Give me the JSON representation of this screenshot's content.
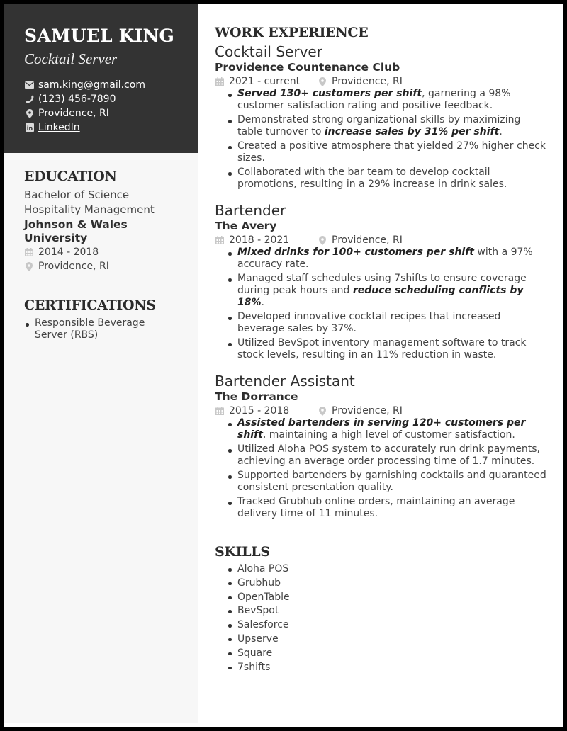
{
  "header": {
    "name": "SAMUEL KING",
    "title": "Cocktail Server",
    "contacts": {
      "email": "sam.king@gmail.com",
      "phone": "(123) 456-7890",
      "location": "Providence, RI",
      "linkedin": "LinkedIn"
    }
  },
  "education": {
    "heading": "EDUCATION",
    "degree": "Bachelor of Science",
    "field": "Hospitality Management",
    "school": "Johnson & Wales University",
    "dates": "2014 - 2018",
    "location": "Providence, RI"
  },
  "certifications": {
    "heading": "CERTIFICATIONS",
    "items": [
      "Responsible Beverage Server (RBS)"
    ]
  },
  "work": {
    "heading": "WORK EXPERIENCE",
    "jobs": [
      {
        "title": "Cocktail Server",
        "company": "Providence Countenance Club",
        "dates": "2021 - current",
        "location": "Providence, RI",
        "bullets": [
          {
            "pre": "",
            "bold": "Served 130+ customers per shift",
            "post": ", garnering a 98% customer satisfaction rating and positive feedback."
          },
          {
            "pre": "Demonstrated strong organizational skills by maximizing table turnover to ",
            "bold": "increase sales by 31% per shift",
            "post": "."
          },
          {
            "pre": "Created a positive atmosphere that yielded 27% higher check sizes.",
            "bold": "",
            "post": ""
          },
          {
            "pre": "Collaborated with the bar team to develop cocktail promotions, resulting in a 29% increase in drink sales.",
            "bold": "",
            "post": ""
          }
        ]
      },
      {
        "title": "Bartender",
        "company": "The Avery",
        "dates": "2018 - 2021",
        "location": "Providence, RI",
        "bullets": [
          {
            "pre": "",
            "bold": "Mixed drinks for 100+ customers per shift",
            "post": " with a 97% accuracy rate."
          },
          {
            "pre": "Managed staff schedules using 7shifts to ensure coverage during peak hours and ",
            "bold": "reduce scheduling conflicts by 18%",
            "post": "."
          },
          {
            "pre": "Developed innovative cocktail recipes that increased beverage sales by 37%.",
            "bold": "",
            "post": ""
          },
          {
            "pre": "Utilized BevSpot inventory management software to track stock levels, resulting in an 11% reduction in waste.",
            "bold": "",
            "post": ""
          }
        ]
      },
      {
        "title": "Bartender Assistant",
        "company": "The Dorrance",
        "dates": "2015 - 2018",
        "location": "Providence, RI",
        "bullets": [
          {
            "pre": "",
            "bold": "Assisted bartenders in serving 120+ customers per shift",
            "post": ", maintaining a high level of customer satisfaction."
          },
          {
            "pre": "Utilized Aloha POS system to accurately run drink payments, achieving an average order processing time of 1.7 minutes.",
            "bold": "",
            "post": ""
          },
          {
            "pre": "Supported bartenders by garnishing cocktails and guaranteed consistent presentation quality.",
            "bold": "",
            "post": ""
          },
          {
            "pre": "Tracked Grubhub online orders, maintaining an average delivery time of 11 minutes.",
            "bold": "",
            "post": ""
          }
        ]
      }
    ]
  },
  "skills": {
    "heading": "SKILLS",
    "items": [
      "Aloha POS",
      "Grubhub",
      "OpenTable",
      "BevSpot",
      "Salesforce",
      "Upserve",
      "Square",
      "7shifts"
    ]
  },
  "icons": {
    "email": "envelope-icon",
    "phone": "phone-icon",
    "location": "map-pin-icon",
    "linkedin": "linkedin-icon",
    "date": "calendar-icon"
  },
  "colors": {
    "sidebar_header": "#333333",
    "sidebar_body": "#f7f7f7",
    "frame": "#000000",
    "text": "#2e2e2e",
    "meta_icon": "#c8c8c8"
  }
}
